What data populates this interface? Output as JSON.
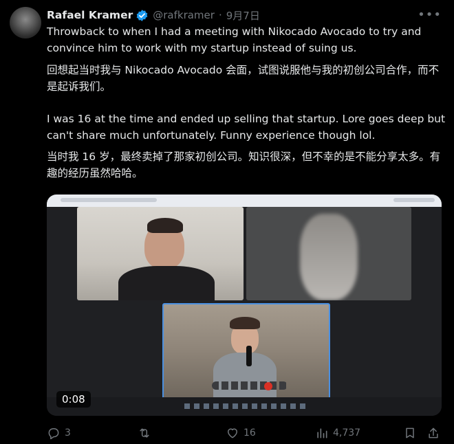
{
  "tweet": {
    "author_name": "Rafael Kramer",
    "handle": "@rafkramer",
    "separator": "·",
    "date": "9月7日",
    "more_icon": "more-icon",
    "verified_icon": "verified-badge-icon",
    "accent": "#1d9bf0",
    "paragraph_1": "Throwback to when I had a meeting with Nikocado Avocado to try and convince him to work with my startup instead of suing us.",
    "paragraph_2": "回想起当时我与 Nikocado Avocado 会面，试图说服他与我的初创公司合作，而不是起诉我们。",
    "paragraph_3": "I was 16 at the time and ended up selling that startup. Lore goes deep but can't share much unfortunately. Funny experience though lol.",
    "paragraph_4": "当时我 16 岁，最终卖掉了那家初创公司。知识很深，但不幸的是不能分享太多。有趣的经历虽然哈哈。"
  },
  "media": {
    "duration": "0:08"
  },
  "actions": {
    "replies": "3",
    "retweets": "",
    "likes": "16",
    "views": "4,737"
  }
}
